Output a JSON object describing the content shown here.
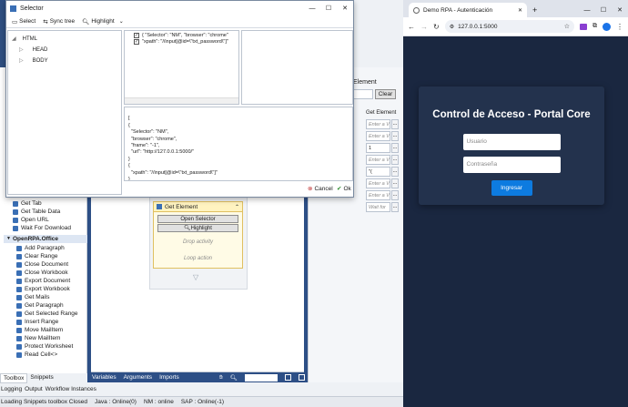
{
  "selector": {
    "title": "Selector",
    "toolbar": {
      "select": "Select",
      "sync_tree": "Sync tree",
      "highlight": "Highlight",
      "more": "⌄"
    },
    "tree": [
      {
        "label": "HTML",
        "indent": 0
      },
      {
        "label": "HEAD",
        "indent": 1
      },
      {
        "label": "BODY",
        "indent": 1
      }
    ],
    "props": [
      "{   \"Selector\": \"NM\",   \"browser\": \"chrome\"",
      "\"xpath\": \"//input[@id=\\\"txt_password\\\"]\""
    ],
    "json_text": [
      "[",
      "{",
      "  \"Selector\": \"NM\",",
      "  \"browser\": \"chrome\",",
      "  \"frame\": \"-1\",",
      "  \"url\": \"http://127.0.0.1:5000/\"",
      "}",
      "{",
      "  \"xpath\": \"//input[@id=\\\"txt_password\\\"]\"",
      "}"
    ],
    "cancel": "Cancel",
    "ok": "Ok"
  },
  "openrpa": {
    "right_panel_title": "Element",
    "clear": "Clear",
    "get_element_label": "Get Element",
    "input_placeholders": [
      "Enter a V",
      "Enter a V",
      "1",
      "Enter a V",
      "\"(",
      "Enter a V",
      "Enter a V",
      "Wait for"
    ],
    "activity": {
      "title": "Get Element",
      "open_selector": "Open Selector",
      "highlight": "Highlight",
      "drop_activity": "Drop activity",
      "loop_action": "Loop action"
    },
    "toolbox_top": [
      "Get Tab",
      "Get Table Data",
      "Open URL",
      "Wait For Download"
    ],
    "office_group": "OpenRPA.Office",
    "toolbox_office": [
      "Add Paragraph",
      "Clear Range",
      "Close Document",
      "Close Workbook",
      "Export Document",
      "Export Workbook",
      "Get Mails",
      "Get Paragraph",
      "Get Selected Range",
      "Insert Range",
      "Move MailItem",
      "New MailItem",
      "Protect Worksheet",
      "Read Cell<>"
    ],
    "bottom_tabs": [
      "Toolbox",
      "Snippets"
    ],
    "designer_tabs": [
      "Variables",
      "Arguments",
      "Imports"
    ],
    "output_tabs": [
      "Logging",
      "Output",
      "Workflow Instances"
    ],
    "status": [
      "Loading Snippets toolbox Closed",
      "Java : Online(0)",
      "NM : online",
      "SAP : Online(-1)"
    ]
  },
  "chrome": {
    "tab_title": "Demo RPA - Autenticación",
    "url": "127.0.0.1:5000",
    "card_title": "Control de Acceso - Portal Core",
    "username_placeholder": "Usuario",
    "password_placeholder": "Contraseña",
    "submit": "Ingresar",
    "colors": {
      "page_bg": "#1a2740",
      "card_bg": "#23324d",
      "button": "#0d7be0"
    }
  }
}
